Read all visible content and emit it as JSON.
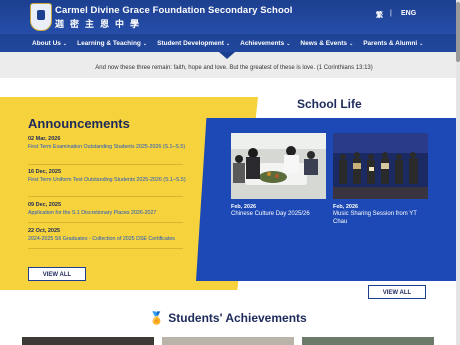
{
  "header": {
    "school_name_en": "Carmel Divine Grace Foundation Secondary School",
    "school_name_zh": "迦密主恩中學",
    "lang_tc": "繁",
    "lang_sep": "|",
    "lang_en": "ENG"
  },
  "nav": {
    "items": [
      {
        "label": "About Us"
      },
      {
        "label": "Learning & Teaching"
      },
      {
        "label": "Student Development"
      },
      {
        "label": "Achievements"
      },
      {
        "label": "News & Events"
      },
      {
        "label": "Parents & Alumni"
      }
    ],
    "chevron": "⌄"
  },
  "quote": "And now these three remain: faith, hope and love. But the greatest of these is love.  (1 Corinthians 13:13)",
  "announcements": {
    "title": "Announcements",
    "items": [
      {
        "date": "02 Mar, 2026",
        "text": "First Term Examination Outstanding Students 2025-2026 (S.1–S.5)"
      },
      {
        "date": "16 Dec, 2025",
        "text": "First Term Uniform Test Outstanding Students 2025-2026 (S.1–S.5)"
      },
      {
        "date": "09 Dec, 2025",
        "text": "Application for the S.1 Discretionary Places 2026-2027"
      },
      {
        "date": "22 Oct, 2025",
        "text": "2024-2025 S6 Graduates - Collection of 2025 DSE Certificates"
      }
    ],
    "view_all": "VIEW ALL"
  },
  "school_life": {
    "title": "School Life",
    "items": [
      {
        "date": "Feb, 2026",
        "caption": "Chinese Culture Day 2025/26"
      },
      {
        "date": "Feb, 2026",
        "caption": "Music Sharing Session from YT Chau"
      }
    ],
    "view_all": "VIEW ALL"
  },
  "achievements": {
    "title": "Students' Achievements",
    "icon": "medal-icon"
  },
  "colors": {
    "header_blue": "#1d3f8f",
    "accent_yellow": "#f6d23c",
    "panel_blue": "#1c49b5",
    "link_blue": "#1f57c7"
  }
}
